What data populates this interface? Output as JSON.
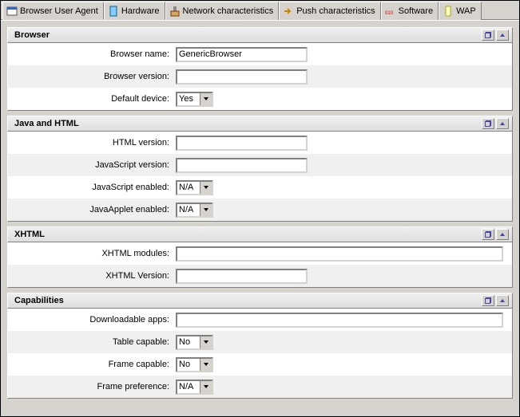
{
  "tabs": [
    {
      "label": "Browser User Agent",
      "active": true
    },
    {
      "label": "Hardware",
      "active": false
    },
    {
      "label": "Network characteristics",
      "active": false
    },
    {
      "label": "Push characteristics",
      "active": false
    },
    {
      "label": "Software",
      "active": false
    },
    {
      "label": "WAP",
      "active": false
    }
  ],
  "sections": {
    "browser": {
      "title": "Browser",
      "name_label": "Browser name:",
      "name_value": "GenericBrowser",
      "version_label": "Browser version:",
      "version_value": "",
      "default_label": "Default device:",
      "default_value": "Yes"
    },
    "java": {
      "title": "Java and HTML",
      "html_label": "HTML version:",
      "html_value": "",
      "js_label": "JavaScript version:",
      "js_value": "",
      "jse_label": "JavaScript enabled:",
      "jse_value": "N/A",
      "jae_label": "JavaApplet enabled:",
      "jae_value": "N/A"
    },
    "xhtml": {
      "title": "XHTML",
      "modules_label": "XHTML modules:",
      "modules_value": "",
      "version_label": "XHTML Version:",
      "version_value": ""
    },
    "caps": {
      "title": "Capabilities",
      "dl_label": "Downloadable apps:",
      "dl_value": "",
      "table_label": "Table capable:",
      "table_value": "No",
      "frame_label": "Frame capable:",
      "frame_value": "No",
      "framepref_label": "Frame preference:",
      "framepref_value": "N/A"
    }
  }
}
